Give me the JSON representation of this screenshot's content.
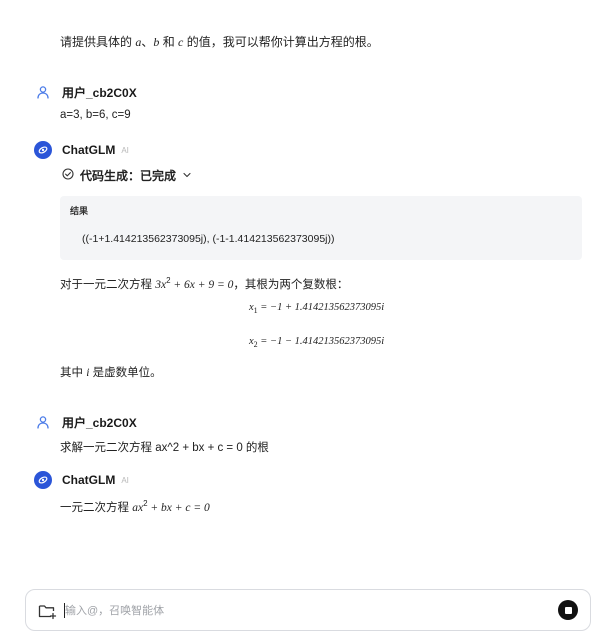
{
  "intro": {
    "before": "请提供具体的 ",
    "a": "a",
    "sep1": "、",
    "b": "b",
    "and": " 和 ",
    "c": "c",
    "after": " 的值，我可以帮你计算出方程的根。"
  },
  "messages": [
    {
      "name": "用户_cb2C0X",
      "text": "a=3, b=6, c=9"
    },
    {
      "name": "ChatGLM",
      "ai_tag": "AI"
    },
    {
      "name": "用户_cb2C0X",
      "text": "求解一元二次方程 ax^2 + bx + c = 0 的根"
    },
    {
      "name": "ChatGLM",
      "ai_tag": "AI"
    }
  ],
  "codegen": {
    "label": "代码生成：",
    "status": "已完成"
  },
  "result": {
    "label": "结果",
    "value": "((-1+1.414213562373095j), (-1-1.414213562373095j))"
  },
  "answer": {
    "line_before": "对于一元二次方程 ",
    "eq_left": "3x",
    "eq_right": " + 6x + 9 = 0",
    "line_after": "，其根为两个复数根：",
    "x1_lhs": "x",
    "x1_rhs": " = −1 + 1.414213562373095i",
    "x2_lhs": "x",
    "x2_rhs": " = −1 − 1.414213562373095i",
    "note_before": "其中 ",
    "note_i": "i",
    "note_after": " 是虚数单位。"
  },
  "answer2": {
    "prefix": "一元二次方程 ",
    "eq_left": "ax",
    "eq_right": " + bx + c = 0"
  },
  "input": {
    "placeholder": "输入@，召唤智能体"
  },
  "math": {
    "sup2": "2",
    "sub1": "1",
    "sub2": "2"
  },
  "colors": {
    "bot_avatar": "#2b55d8",
    "result_bg": "#f4f5f7"
  }
}
